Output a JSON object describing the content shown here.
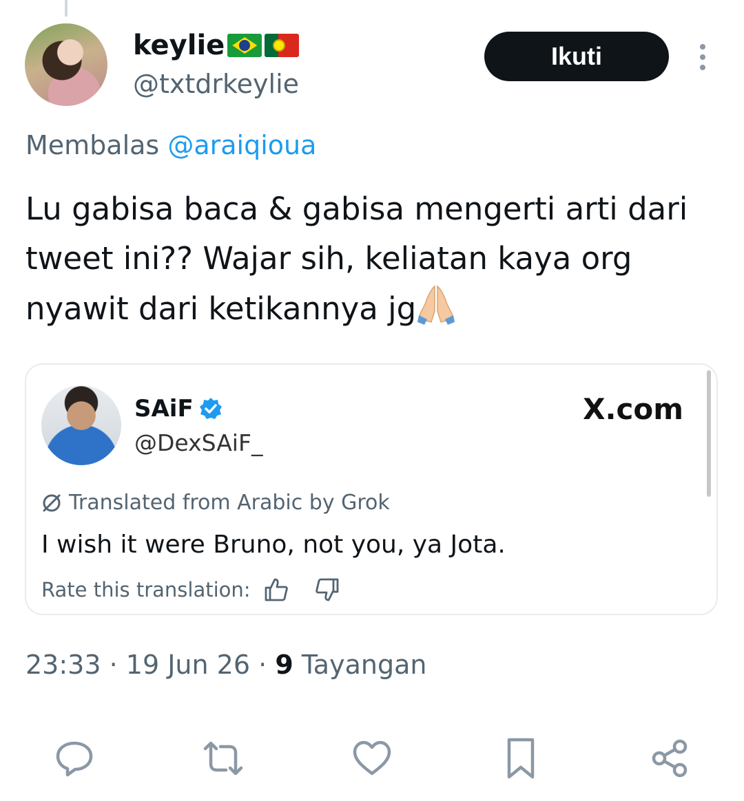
{
  "tweet": {
    "author": {
      "name": "keylie",
      "flags": [
        "brazil-flag",
        "portugal-flag"
      ],
      "handle": "@txtdrkeylie"
    },
    "follow_label": "Ikuti",
    "reply_prefix": "Membalas",
    "reply_to": "@araiqioua",
    "text": "Lu gabisa baca & gabisa mengerti arti dari tweet ini?? Wajar sih, keliatan kaya org nyawit dari ketikannya jg",
    "emoji": "folded-hands-emoji",
    "time": "23:33",
    "date": "19 Jun 26",
    "views": "9",
    "views_label": "Tayangan"
  },
  "quote": {
    "name": "SAiF",
    "handle": "@DexSAiF_",
    "site": "X.com",
    "translated_label": "Translated from Arabic by Grok",
    "text": "I wish it were Bruno, not you, ya Jota.",
    "rate_label": "Rate this translation:"
  },
  "actions": [
    "reply-icon",
    "retweet-icon",
    "like-icon",
    "bookmark-icon",
    "share-icon"
  ],
  "colors": {
    "text": "#0f1419",
    "secondary": "#536471",
    "link": "#1d9bf0",
    "button_bg": "#0f1419",
    "icon": "#8b98a5"
  }
}
